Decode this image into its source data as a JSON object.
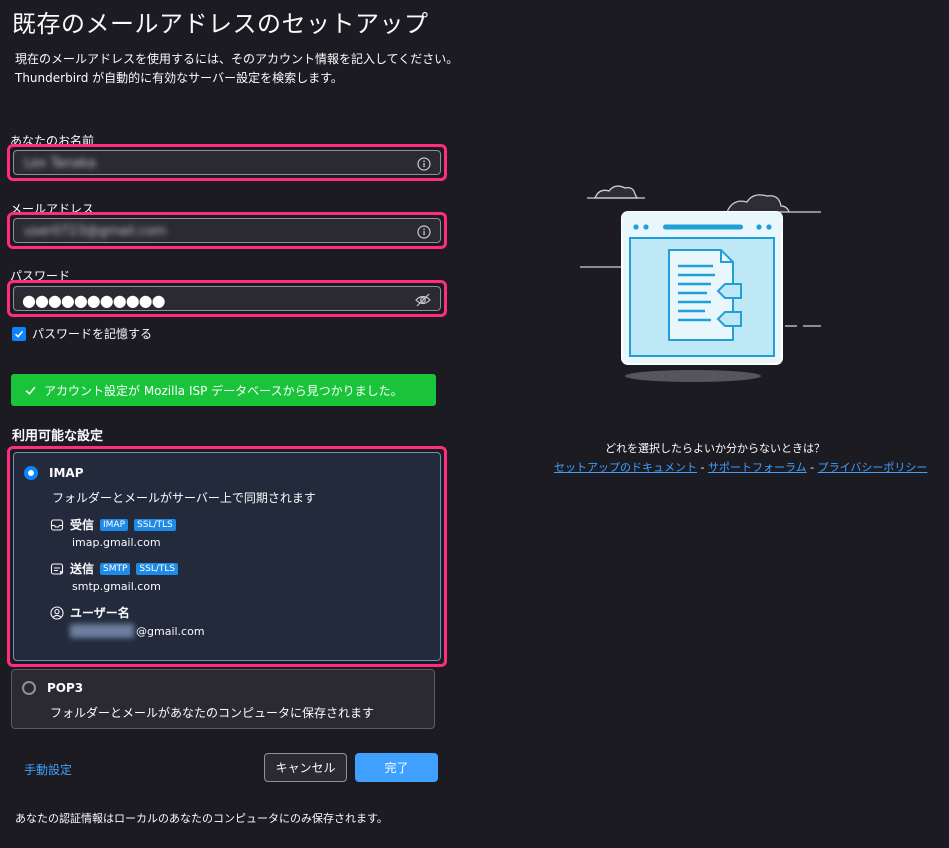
{
  "page": {
    "title": "既存のメールアドレスのセットアップ",
    "desc_line1": "現在のメールアドレスを使用するには、そのアカウント情報を記入してください。",
    "desc_line2": "Thunderbird が自動的に有効なサーバー設定を検索します。"
  },
  "form": {
    "name_label": "あなたのお名前",
    "name_value": "Lex Tanaka",
    "email_label": "メールアドレス",
    "email_value": "user0723@gmail.com",
    "password_label": "パスワード",
    "password_value": "●●●●●●●●●●●",
    "remember_label": "パスワードを記憶する",
    "remember_checked": true
  },
  "status": {
    "found_text": "アカウント設定が Mozilla ISP データベースから見つかりました。"
  },
  "config": {
    "section_title": "利用可能な設定",
    "imap": {
      "name": "IMAP",
      "desc": "フォルダーとメールがサーバー上で同期されます",
      "incoming_label": "受信",
      "incoming_badges": [
        "IMAP",
        "SSL/TLS"
      ],
      "incoming_host": "imap.gmail.com",
      "outgoing_label": "送信",
      "outgoing_badges": [
        "SMTP",
        "SSL/TLS"
      ],
      "outgoing_host": "smtp.gmail.com",
      "user_label": "ユーザー名",
      "user_value": "@gmail.com"
    },
    "pop3": {
      "name": "POP3",
      "desc": "フォルダーとメールがあなたのコンピュータに保存されます"
    }
  },
  "actions": {
    "manual": "手動設定",
    "cancel": "キャンセル",
    "done": "完了"
  },
  "footnote": "あなたの認証情報はローカルのあなたのコンピュータにのみ保存されます。",
  "help": {
    "question": "どれを選択したらよいか分からないときは？",
    "link_docs": "セットアップのドキュメント",
    "link_forum": "サポートフォーラム",
    "link_privacy": "プライバシーポリシー",
    "sep": " - "
  },
  "colors": {
    "highlight": "#ff2d7e",
    "success": "#19c43b",
    "accent": "#0a84ff"
  }
}
